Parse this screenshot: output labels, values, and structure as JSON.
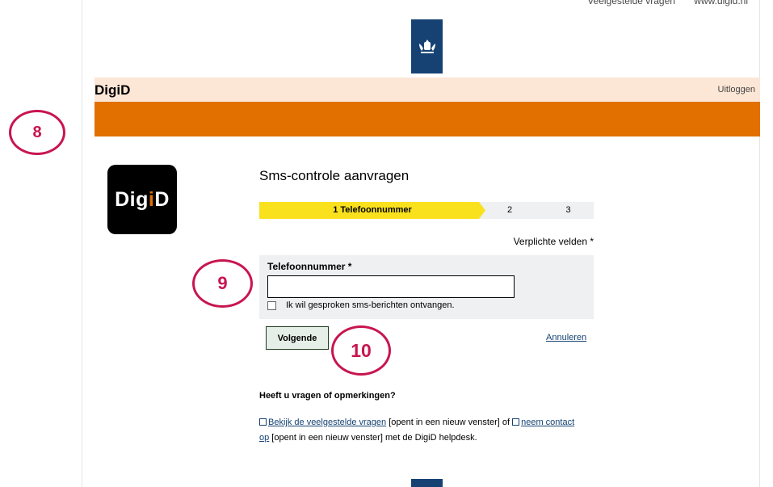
{
  "header": {
    "top_links": [
      "Veelgestelde vragen",
      "www.digid.nl"
    ],
    "brand": "DigiD",
    "logout_label": "Uitloggen"
  },
  "logo": {
    "text_white": "Dig",
    "text_orange": "i",
    "text_end": "D"
  },
  "main": {
    "title": "Sms-controle aanvragen",
    "steps": [
      {
        "label": "1 Telefoonnummer",
        "active": true
      },
      {
        "label": "2",
        "active": false
      },
      {
        "label": "3",
        "active": false
      }
    ],
    "required_note": "Verplichte velden *",
    "form": {
      "phone_label": "Telefoonnummer *",
      "phone_value": "",
      "voice_checkbox_label": "Ik wil gesproken sms-berichten ontvangen.",
      "voice_checked": false
    },
    "next_button": "Volgende",
    "cancel_link": "Annuleren"
  },
  "help": {
    "heading": "Heeft u vragen of opmerkingen?",
    "faq_link": "Bekijk de veelgestelde vragen",
    "new_window_1": " [opent in een nieuw venster] of ",
    "contact_link_a": "neem contact",
    "contact_link_b": "op",
    "new_window_2": " [opent in een nieuw venster] met de DigiD helpdesk."
  },
  "annotations": {
    "badge_8": "8",
    "badge_9": "9",
    "badge_10": "10"
  },
  "colors": {
    "accent_orange": "#e17000",
    "header_peach": "#fce6d6",
    "rijksoverheid_blue": "#154273",
    "step_yellow": "#f9e11e",
    "badge_red": "#c8154f"
  }
}
